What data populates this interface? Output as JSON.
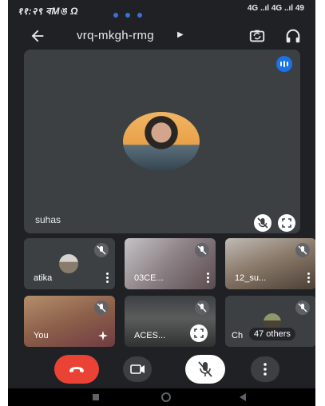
{
  "status_bar": {
    "left_text": "११:२९ ৰMঙ Ω",
    "right_text": "4G ..ıl 4G ..ıl 49"
  },
  "top_bar": {
    "meeting_code": "vrq-mkgh-rmg"
  },
  "main_tile": {
    "participant_name": "suhas"
  },
  "tiles": [
    {
      "name": "atika"
    },
    {
      "name": "03CE..."
    },
    {
      "name": "12_su..."
    },
    {
      "name": "You"
    },
    {
      "name": "ACES..."
    },
    {
      "name": "47 others",
      "prefix": "Ch"
    }
  ],
  "colors": {
    "end_call": "#ea4335",
    "background": "#202124",
    "tile": "#3c4043",
    "accent": "#1a73e8"
  },
  "icons": {
    "back": "arrow-left-icon",
    "switch_camera": "switch-camera-icon",
    "audio": "headphones-icon",
    "mute": "mic-off-icon",
    "expand": "fullscreen-icon",
    "more": "more-vert-icon",
    "end_call": "phone-hangup-icon",
    "camera": "videocam-icon",
    "effects": "sparkle-icon"
  }
}
